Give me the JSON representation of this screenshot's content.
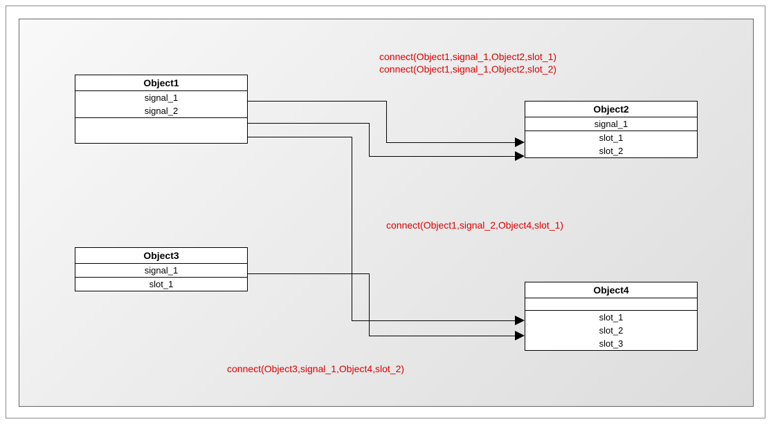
{
  "objects": {
    "obj1": {
      "title": "Object1",
      "signals": [
        "signal_1",
        "signal_2"
      ],
      "slots": []
    },
    "obj2": {
      "title": "Object2",
      "signals": [
        "signal_1"
      ],
      "slots": [
        "slot_1",
        "slot_2"
      ]
    },
    "obj3": {
      "title": "Object3",
      "signals": [
        "signal_1"
      ],
      "slots": [
        "slot_1"
      ]
    },
    "obj4": {
      "title": "Object4",
      "signals": [],
      "slots": [
        "slot_1",
        "slot_2",
        "slot_3"
      ]
    }
  },
  "connections": {
    "c1": "connect(Object1,signal_1,Object2,slot_1)",
    "c2": "connect(Object1,signal_1,Object2,slot_2)",
    "c3": "connect(Object1,signal_2,Object4,slot_1)",
    "c4": "connect(Object3,signal_1,Object4,slot_2)"
  }
}
